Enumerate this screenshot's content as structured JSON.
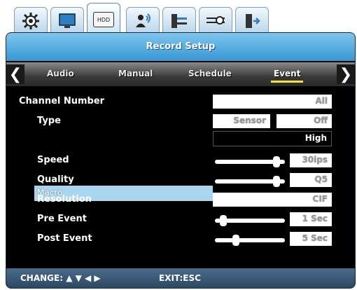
{
  "icons": [
    "gear-icon",
    "monitor-icon",
    "hdd-icon",
    "user-network-icon",
    "network-icon",
    "settings-slider-icon",
    "exit-door-icon"
  ],
  "hdd_label": "HDD",
  "title": "Record Setup",
  "subtabs": [
    "Audio",
    "Manual",
    "Schedule",
    "Event"
  ],
  "active_subtab": "Event",
  "rows": {
    "channel_number": {
      "label": "Channel Number",
      "value": "All"
    },
    "type": {
      "label": "Type",
      "value1": "Sensor",
      "value2": "Off"
    },
    "macro": {
      "label": "Macro",
      "value": "High"
    },
    "speed": {
      "label": "Speed",
      "value": "30ips",
      "level": 0.88
    },
    "quality": {
      "label": "Quality",
      "value": "Q5",
      "level": 0.88
    },
    "resolution": {
      "label": "Resolution",
      "value": "CIF"
    },
    "pre_event": {
      "label": "Pre Event",
      "value": "1 Sec",
      "level": 0.12
    },
    "post_event": {
      "label": "Post Event",
      "value": "5 Sec",
      "level": 0.3
    }
  },
  "footer": {
    "change": "CHANGE: ▲ ▼ ◀ ▶",
    "exit": "EXIT:ESC"
  },
  "colors": {
    "title_bar": "#3796d2",
    "highlight": "#a9d6ef",
    "footer": "#2c4862",
    "active_underline": "#f5e23c"
  }
}
